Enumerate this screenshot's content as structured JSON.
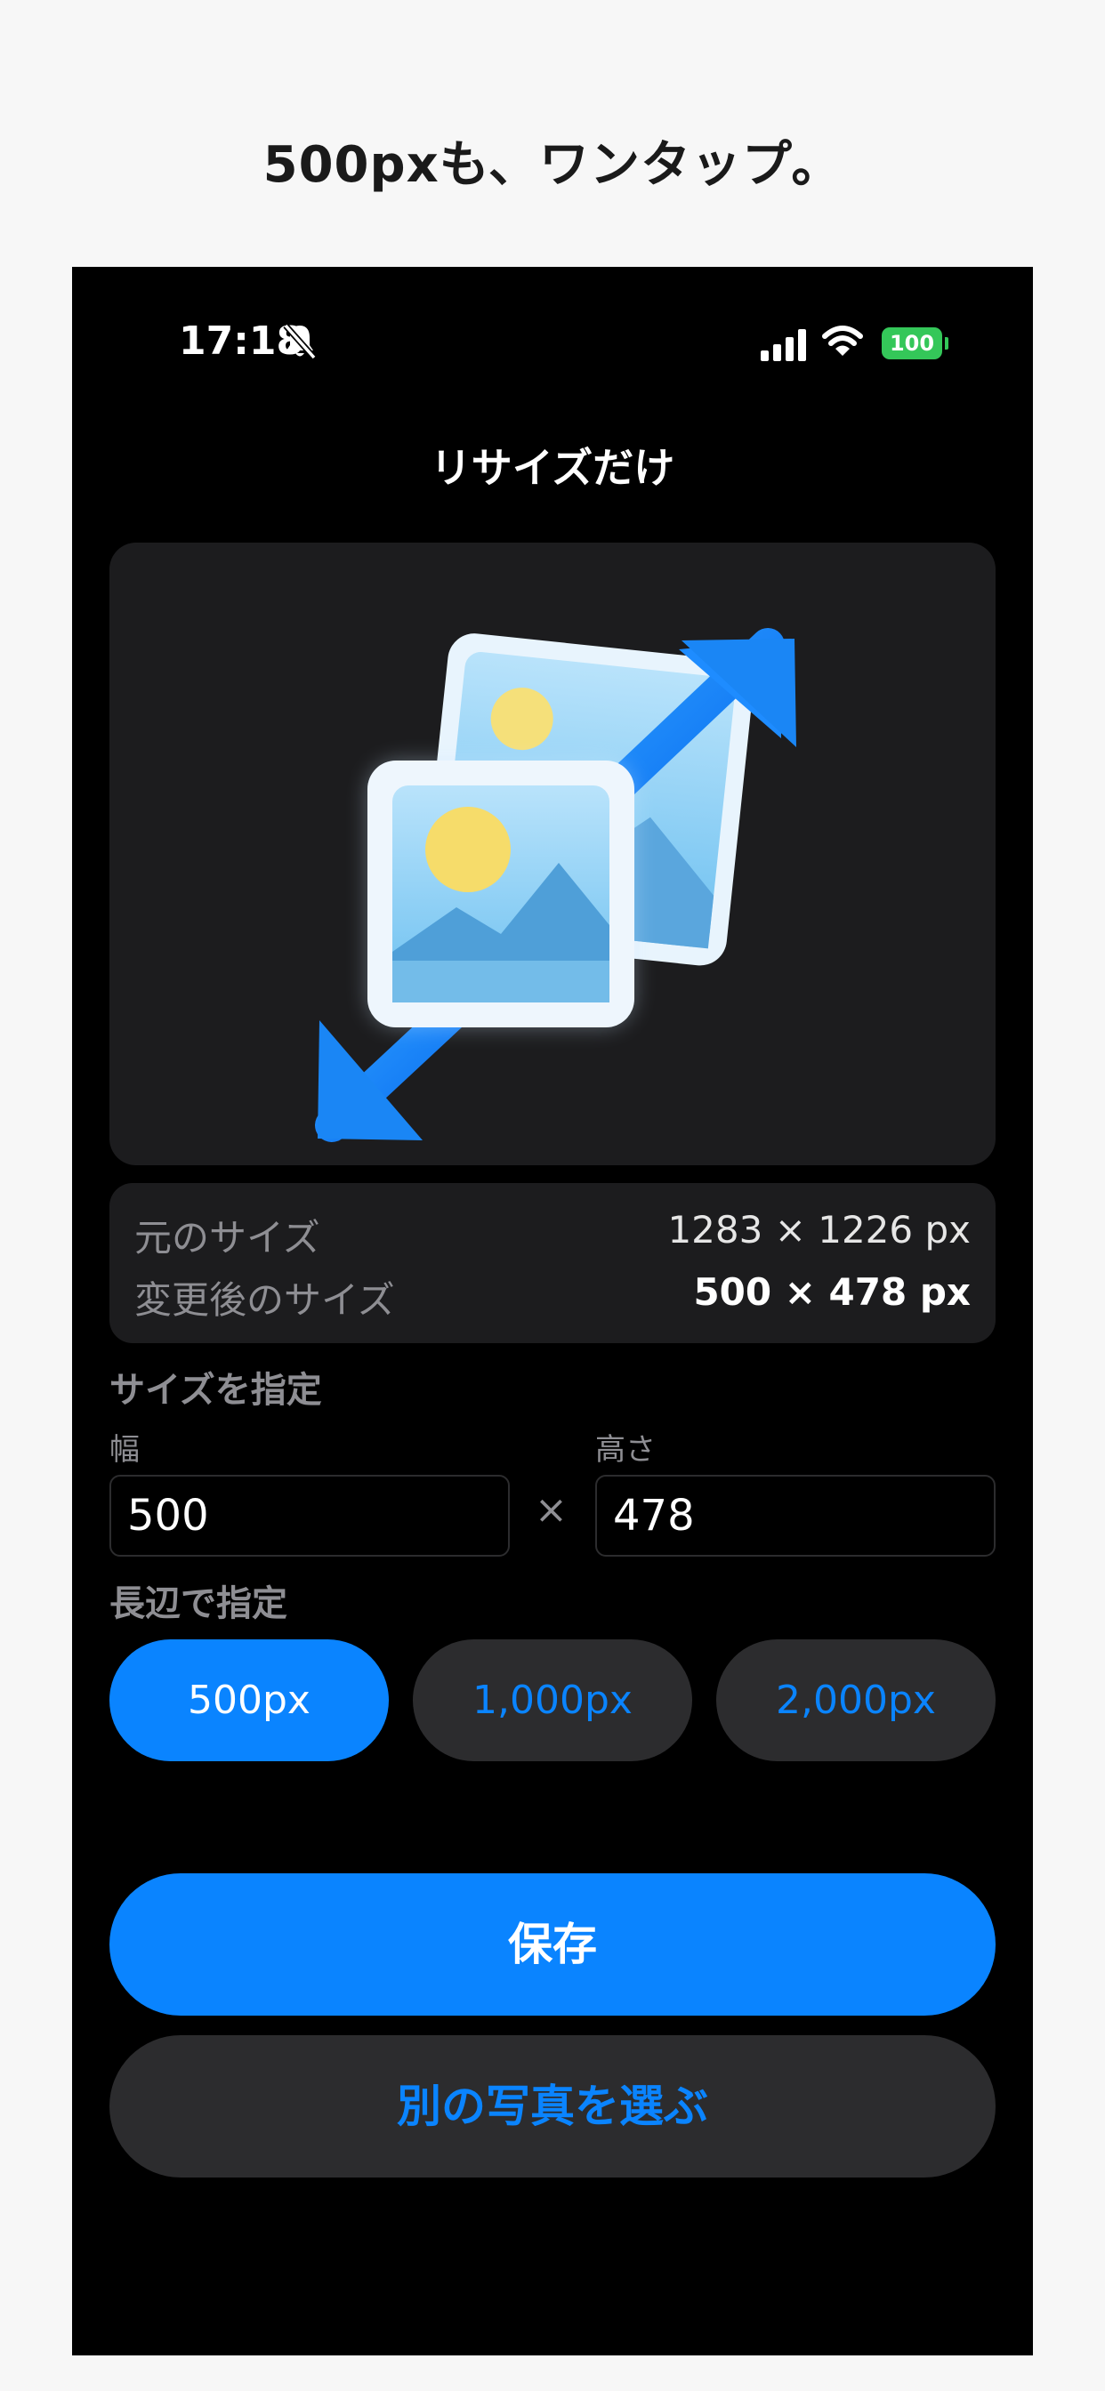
{
  "headline": "500pxも、ワンタップ。",
  "status_bar": {
    "time": "17:18",
    "battery": "100",
    "icons": [
      "bell-slash-icon",
      "cellular-signal-icon",
      "wifi-icon",
      "battery-icon"
    ]
  },
  "nav": {
    "title": "リサイズだけ"
  },
  "preview": {
    "icon": "image-resize-icon"
  },
  "info": {
    "original_label": "元のサイズ",
    "original_value": "1283 × 1226 px",
    "resized_label": "変更後のサイズ",
    "resized_value": "500 × 478 px"
  },
  "size_section": {
    "title": "サイズを指定",
    "width_label": "幅",
    "width_value": "500",
    "times": "×",
    "height_label": "高さ",
    "height_value": "478"
  },
  "long_edge_section": {
    "title": "長辺で指定",
    "options": [
      {
        "label": "500px",
        "selected": true
      },
      {
        "label": "1,000px",
        "selected": false
      },
      {
        "label": "2,000px",
        "selected": false
      }
    ]
  },
  "actions": {
    "save_label": "保存",
    "choose_label": "別の写真を選ぶ"
  },
  "colors": {
    "accent": "#0a84ff",
    "battery": "#34c759",
    "card": "#1c1c1e"
  }
}
